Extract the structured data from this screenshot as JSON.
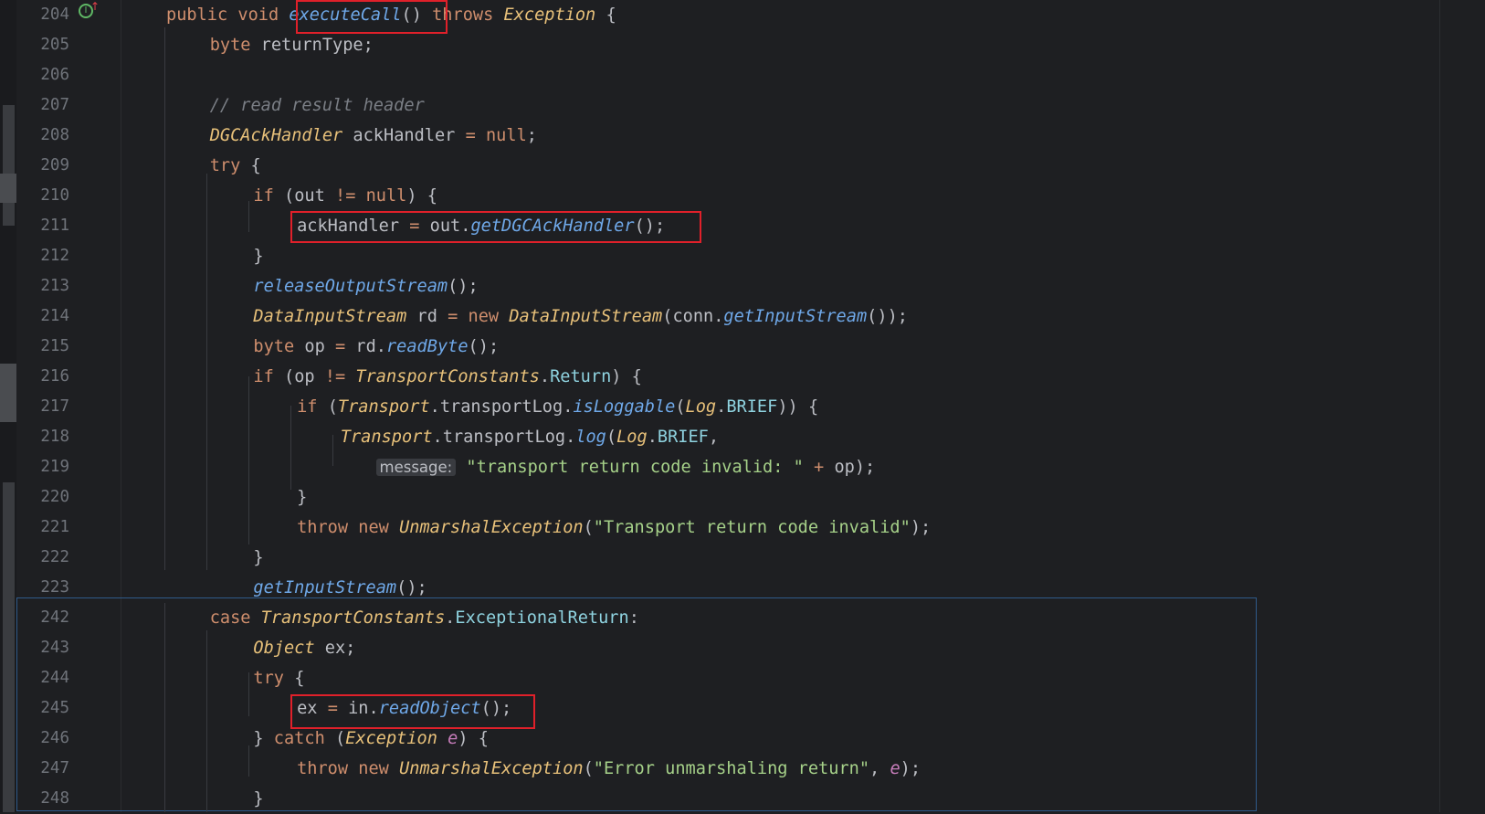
{
  "editor": {
    "gutter_icon": "implements-override-icon",
    "colors": {
      "background": "#1e1f22",
      "highlight_box": "#e0202a",
      "fold_border": "#2f5a8a"
    },
    "inlay_hint": "message:",
    "lines": [
      {
        "n": "204",
        "code": "public void executeCall() throws Exception {"
      },
      {
        "n": "205",
        "code": "byte returnType;"
      },
      {
        "n": "206",
        "code": ""
      },
      {
        "n": "207",
        "code": "// read result header"
      },
      {
        "n": "208",
        "code": "DGCAckHandler ackHandler = null;"
      },
      {
        "n": "209",
        "code": "try {"
      },
      {
        "n": "210",
        "code": "if (out != null) {"
      },
      {
        "n": "211",
        "code": "ackHandler = out.getDGCAckHandler();"
      },
      {
        "n": "212",
        "code": "}"
      },
      {
        "n": "213",
        "code": "releaseOutputStream();"
      },
      {
        "n": "214",
        "code": "DataInputStream rd = new DataInputStream(conn.getInputStream());"
      },
      {
        "n": "215",
        "code": "byte op = rd.readByte();"
      },
      {
        "n": "216",
        "code": "if (op != TransportConstants.Return) {"
      },
      {
        "n": "217",
        "code": "if (Transport.transportLog.isLoggable(Log.BRIEF)) {"
      },
      {
        "n": "218",
        "code": "Transport.transportLog.log(Log.BRIEF,"
      },
      {
        "n": "219",
        "code": "\"transport return code invalid: \" + op);"
      },
      {
        "n": "220",
        "code": "}"
      },
      {
        "n": "221",
        "code": "throw new UnmarshalException(\"Transport return code invalid\");"
      },
      {
        "n": "222",
        "code": "}"
      },
      {
        "n": "223",
        "code": "getInputStream();"
      },
      {
        "n": "242",
        "code": "case TransportConstants.ExceptionalReturn:"
      },
      {
        "n": "243",
        "code": "Object ex;"
      },
      {
        "n": "244",
        "code": "try {"
      },
      {
        "n": "245",
        "code": "ex = in.readObject();"
      },
      {
        "n": "246",
        "code": "} catch (Exception e) {"
      },
      {
        "n": "247",
        "code": "throw new UnmarshalException(\"Error unmarshaling return\", e);"
      },
      {
        "n": "248",
        "code": "}"
      }
    ],
    "highlighted": [
      "executeCall()",
      "ackHandler = out.getDGCAckHandler();",
      "ex = in.readObject();"
    ]
  }
}
